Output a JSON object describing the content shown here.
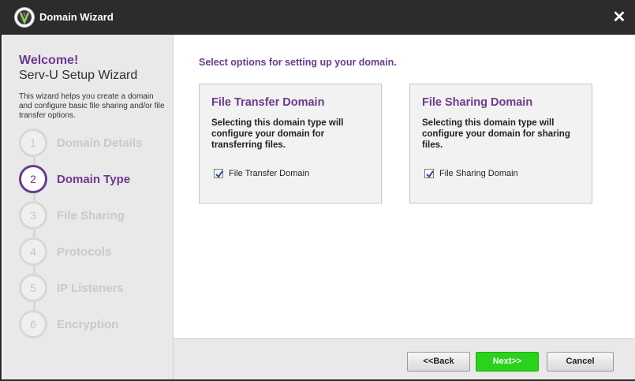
{
  "window": {
    "title": "Domain Wizard",
    "close_icon": "close-icon",
    "logo_icon": "serv-u-logo-icon"
  },
  "sidebar": {
    "welcome": "Welcome!",
    "wizard_name": "Serv-U Setup Wizard",
    "intro": "This wizard helps you create a domain and configure basic file sharing and/or file transfer options.",
    "steps": [
      {
        "number": "1",
        "label": "Domain Details",
        "active": false
      },
      {
        "number": "2",
        "label": "Domain Type",
        "active": true
      },
      {
        "number": "3",
        "label": "File Sharing",
        "active": false
      },
      {
        "number": "4",
        "label": "Protocols",
        "active": false
      },
      {
        "number": "5",
        "label": "IP Listeners",
        "active": false
      },
      {
        "number": "6",
        "label": "Encryption",
        "active": false
      }
    ]
  },
  "main": {
    "heading": "Select options for setting up your domain.",
    "panels": [
      {
        "title": "File Transfer Domain",
        "description": "Selecting this domain type will configure your domain for transferring files.",
        "checkbox_label": "File Transfer Domain",
        "checked": true
      },
      {
        "title": "File Sharing Domain",
        "description": "Selecting this domain type will configure your domain for sharing files.",
        "checkbox_label": "File Sharing Domain",
        "checked": true
      }
    ]
  },
  "footer": {
    "back_label": "<<Back",
    "next_label": "Next>>",
    "cancel_label": "Cancel"
  },
  "colors": {
    "accent": "#6b3a8f",
    "next_button": "#2bd21b",
    "titlebar": "#2c2c2c"
  }
}
